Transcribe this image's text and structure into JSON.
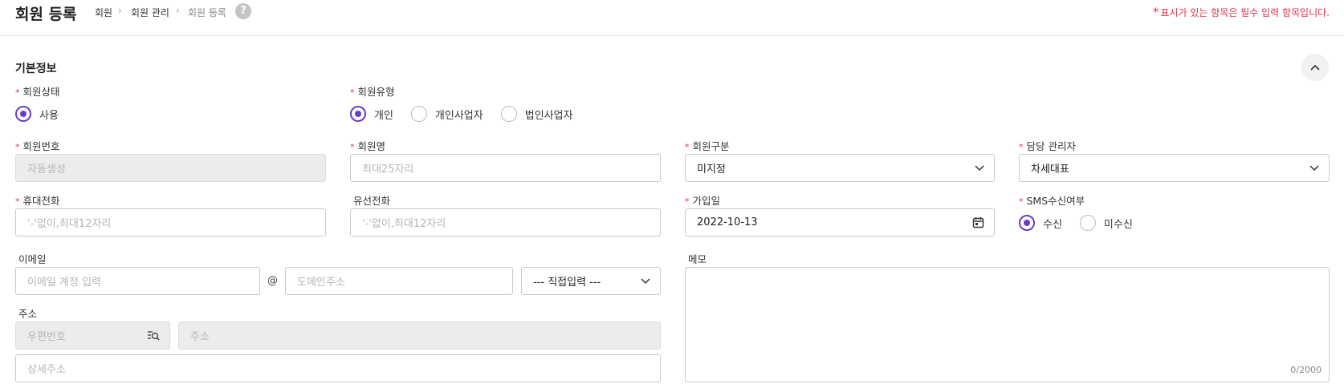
{
  "header": {
    "title": "회원 등록",
    "breadcrumb": [
      "회원",
      "회원 관리",
      "회원 등록"
    ],
    "help_icon": "?",
    "required_star": "*",
    "required_note": "표시가 있는 항목은 필수 입력 항목입니다."
  },
  "section": {
    "title": "기본정보"
  },
  "form": {
    "member_status": {
      "label": "회원상태",
      "options": [
        "사용"
      ],
      "selected": "사용"
    },
    "member_type": {
      "label": "회원유형",
      "options": [
        "개인",
        "개인사업자",
        "법인사업자"
      ],
      "selected": "개인"
    },
    "member_no": {
      "label": "회원번호",
      "placeholder": "자동생성"
    },
    "member_name": {
      "label": "회원명",
      "placeholder": "최대25자리"
    },
    "member_class": {
      "label": "회원구분",
      "value": "미지정"
    },
    "manager": {
      "label": "담당 관리자",
      "value": "차세대표"
    },
    "mobile": {
      "label": "휴대전화",
      "placeholder": "'-'없이,최대12자리"
    },
    "phone": {
      "label": "유선전화",
      "placeholder": "'-'없이,최대12자리"
    },
    "join_date": {
      "label": "가입일",
      "value": "2022-10-13"
    },
    "sms": {
      "label": "SMS수신여부",
      "options": [
        "수신",
        "미수신"
      ],
      "selected": "수신"
    },
    "email": {
      "label": "이메일",
      "account_placeholder": "이메일 계정 입력",
      "at": "@",
      "domain_placeholder": "도메인주소",
      "domain_select": "--- 직접입력 ---"
    },
    "memo": {
      "label": "메모",
      "count": "0/2000"
    },
    "address": {
      "label": "주소",
      "zip_placeholder": "우편번호",
      "addr_placeholder": "주소",
      "detail_placeholder": "상세주소"
    }
  },
  "colors": {
    "accent": "#6a3ec1",
    "required": "#e0344a"
  }
}
